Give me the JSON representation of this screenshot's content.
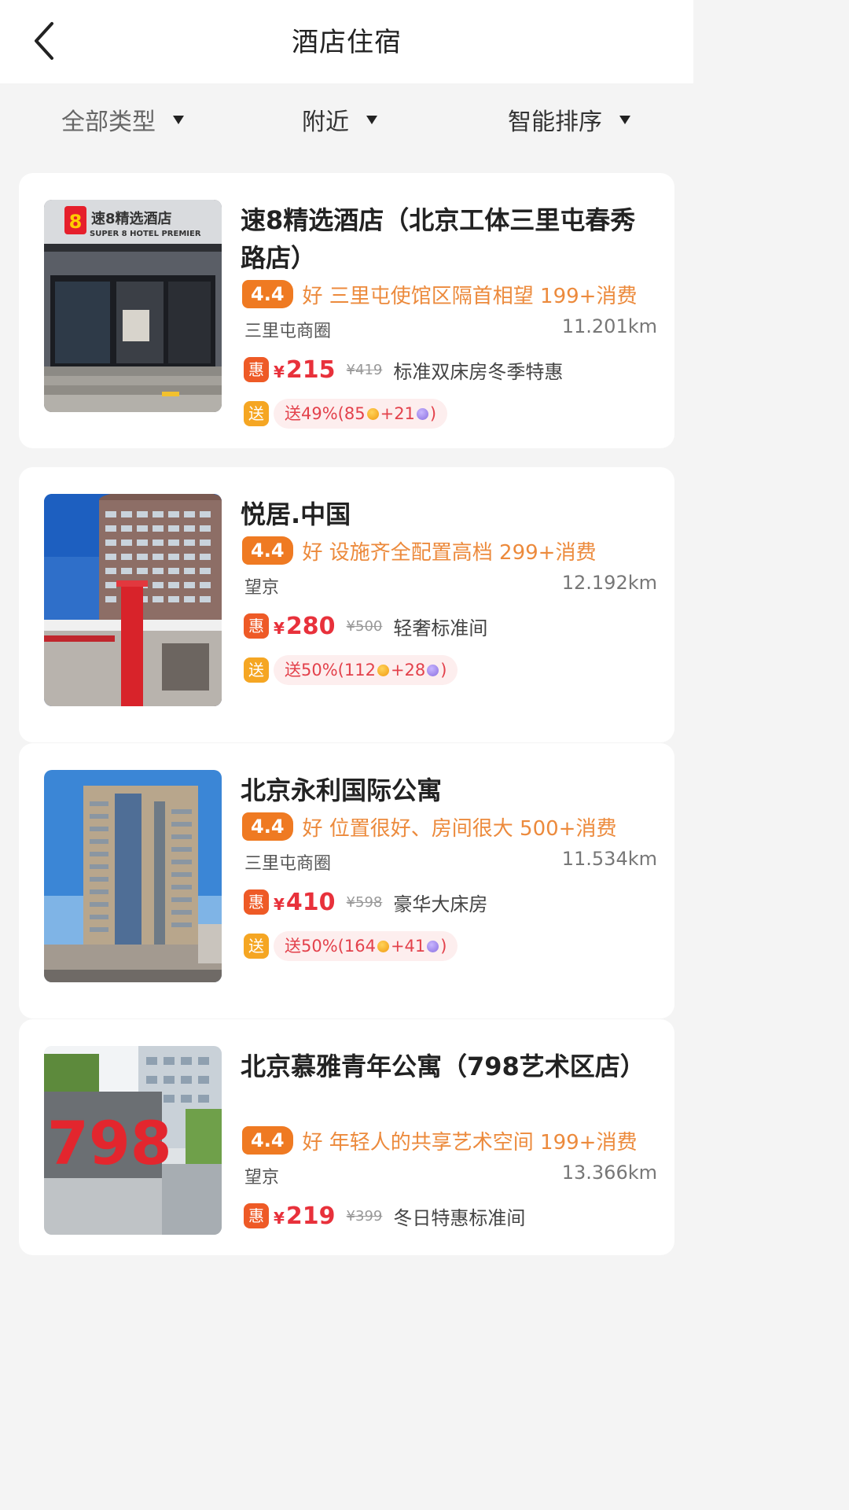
{
  "header": {
    "title": "酒店住宿"
  },
  "filters": [
    {
      "label": "全部类型"
    },
    {
      "label": "附近"
    },
    {
      "label": "智能排序"
    }
  ],
  "hotels": [
    {
      "name": "速8精选酒店（北京工体三里屯春秀路店）",
      "score": "4.4",
      "review": "好 三里屯使馆区隔首相望 199+消费",
      "area": "三里屯商圈",
      "distance": "11.201km",
      "hui": "惠",
      "yen": "¥",
      "price": "215",
      "original_price": "¥419",
      "room": "标准双床房冬季特惠",
      "song": "送",
      "gift_prefix": "送49%(85",
      "gift_mid": "+21",
      "gift_suffix": ")",
      "sign_text_cn": "速8精选酒店",
      "sign_text_en": "SUPER 8 HOTEL PREMIER",
      "logo_text": "8"
    },
    {
      "name": "悦居.中国",
      "score": "4.4",
      "review": "好 设施齐全配置高档 299+消费",
      "area": "望京",
      "distance": "12.192km",
      "hui": "惠",
      "yen": "¥",
      "price": "280",
      "original_price": "¥500",
      "room": "轻奢标准间",
      "song": "送",
      "gift_prefix": "送50%(112",
      "gift_mid": "+28",
      "gift_suffix": ")"
    },
    {
      "name": "北京永利国际公寓",
      "score": "4.4",
      "review": "好 位置很好、房间很大 500+消费",
      "area": "三里屯商圈",
      "distance": "11.534km",
      "hui": "惠",
      "yen": "¥",
      "price": "410",
      "original_price": "¥598",
      "room": "豪华大床房",
      "song": "送",
      "gift_prefix": "送50%(164",
      "gift_mid": "+41",
      "gift_suffix": ")"
    },
    {
      "name": "北京慕雅青年公寓（798艺术区店）",
      "score": "4.4",
      "review": "好 年轻人的共享艺术空间 199+消费",
      "area": "望京",
      "distance": "13.366km",
      "hui": "惠",
      "yen": "¥",
      "price": "219",
      "original_price": "¥399",
      "room": "冬日特惠标准间",
      "sign_text": "798"
    }
  ],
  "colors": {
    "accent_orange": "#ef7a22",
    "price_red": "#e8313b",
    "review_orange": "#ec8a3c",
    "gift_bg": "#fdeeee"
  },
  "icons": {
    "back": "chevron-left-icon",
    "caret": "caret-down-icon",
    "gold_coin": "gold-coin-icon",
    "purple_coin": "purple-coin-icon"
  }
}
